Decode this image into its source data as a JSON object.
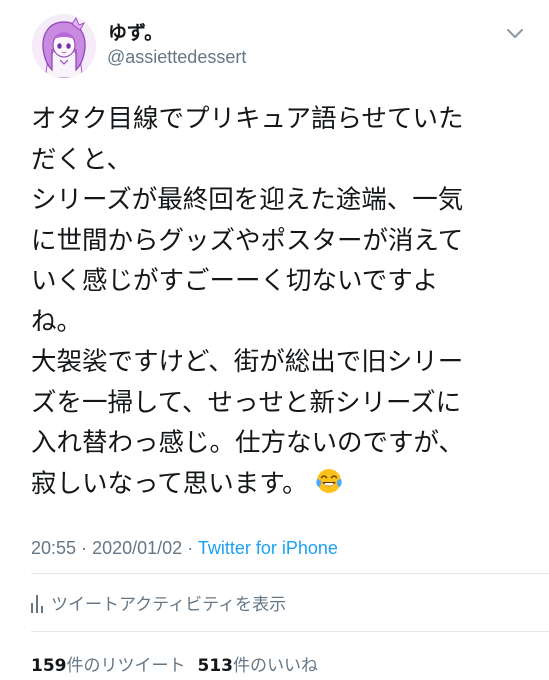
{
  "user": {
    "display_name": "ゆず。",
    "handle": "@assiettedessert"
  },
  "tweet": {
    "lines": [
      "オタク目線でプリキュア語らせていた",
      "だくと、",
      "シリーズが最終回を迎えた途端、一気",
      "に世間からグッズやポスターが消えて",
      "いく感じがすごーーく切ないですよ",
      "ね。",
      "大袈裟ですけど、街が総出で旧シリー",
      "ズを一掃して、せっせと新シリーズに",
      "入れ替わっ感じ。仕方ないのですが、",
      "寂しいなって思います。"
    ],
    "emoji_icon": "face-with-tears-of-joy-emoji"
  },
  "meta": {
    "time": "20:55",
    "separator1": "·",
    "date": "2020/01/02",
    "separator2": "·",
    "source": "Twitter for iPhone"
  },
  "activity": {
    "label": "ツイートアクティビティを表示",
    "icon": "bar-chart-icon"
  },
  "counts": {
    "retweets": "159",
    "retweets_label": "件のリツイート",
    "likes": "513",
    "likes_label": "件のいいね"
  },
  "colors": {
    "text": "#14171a",
    "secondary": "#657786",
    "link": "#1da1f2",
    "divider": "#e1e8ed"
  }
}
